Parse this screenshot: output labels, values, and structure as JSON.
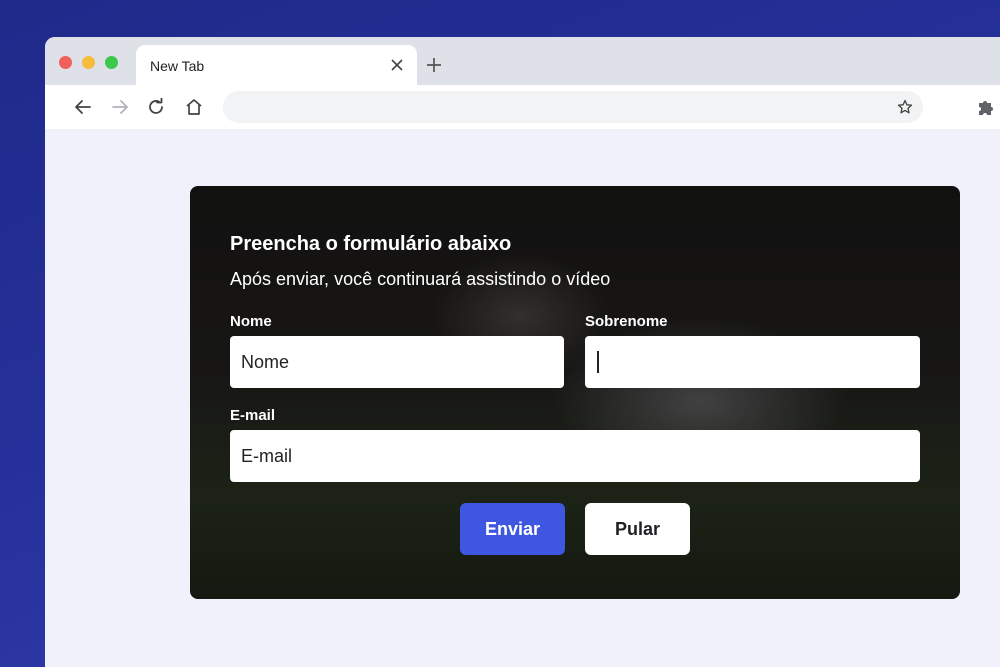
{
  "browser": {
    "tab": {
      "title": "New Tab"
    },
    "omnibox": {
      "value": ""
    },
    "colors": {
      "tab_bar": "#dee1e8",
      "page_bg": "#f0f1fb",
      "desktop": "#26309a"
    },
    "icons": [
      "close-icon",
      "plus-icon",
      "back-arrow-icon",
      "forward-arrow-icon",
      "reload-icon",
      "home-icon",
      "star-icon",
      "puzzle-icon"
    ]
  },
  "form": {
    "title": "Preencha o formulário abaixo",
    "subtitle": "Após enviar, você continuará assistindo o vídeo",
    "fields": {
      "nome": {
        "label": "Nome",
        "placeholder": "Nome"
      },
      "sobrenome": {
        "label": "Sobrenome",
        "placeholder": ""
      },
      "email": {
        "label": "E-mail",
        "placeholder": "E-mail"
      }
    },
    "buttons": {
      "submit": "Enviar",
      "skip": "Pular"
    },
    "colors": {
      "submit_bg": "#3f57e0",
      "skip_bg": "#ffffff"
    }
  }
}
